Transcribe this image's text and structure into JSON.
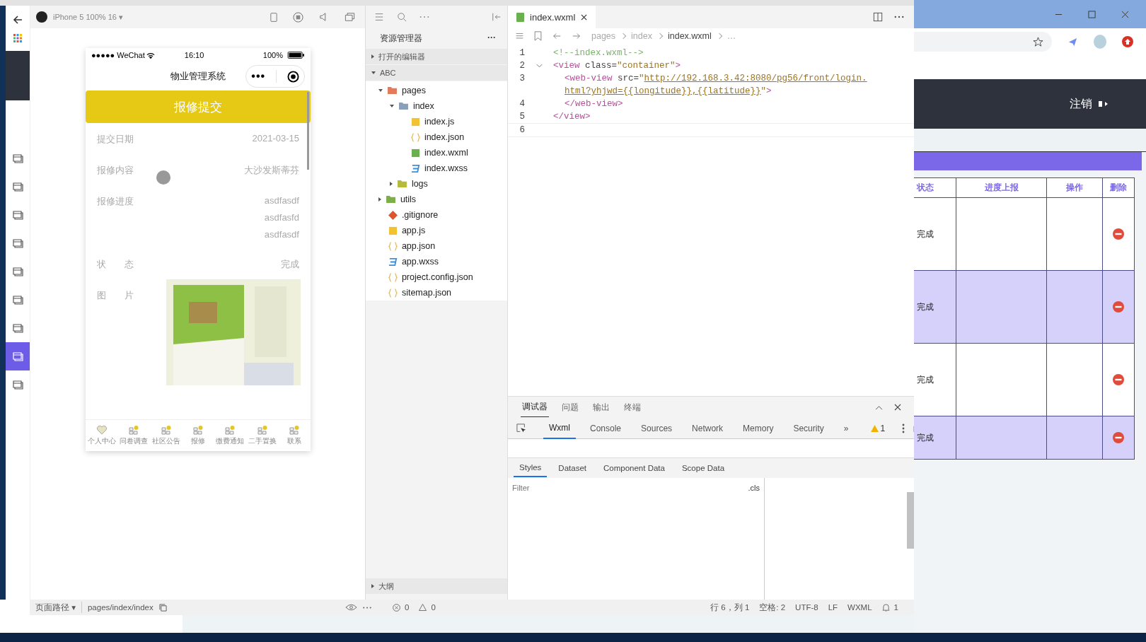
{
  "nav_sidebar": {
    "items": [
      {
        "selected": false
      },
      {
        "selected": false
      },
      {
        "selected": false
      },
      {
        "selected": false
      },
      {
        "selected": false
      },
      {
        "selected": false
      },
      {
        "selected": false
      },
      {
        "selected": true
      },
      {
        "selected": false
      }
    ]
  },
  "simulator": {
    "device": "iPhone 5 100% 16 ▾",
    "phone": {
      "carrier": "●●●●● WeChat",
      "time": "16:10",
      "battery": "100%",
      "title": "物业管理系统",
      "capsule_dots": "•••",
      "submit_button": "报修提交",
      "fields": [
        {
          "kind": "text",
          "label": "提交日期",
          "values": [
            "2021-03-15"
          ]
        },
        {
          "kind": "text",
          "label": "报修内容",
          "values": [
            "大沙发斯蒂芬"
          ]
        },
        {
          "kind": "text",
          "label": "报修进度",
          "values": [
            "asdfasdf",
            "asdfasfd",
            "asdfasdf"
          ]
        },
        {
          "kind": "text",
          "label": "状　　态",
          "values": [
            "完成"
          ]
        },
        {
          "kind": "image",
          "label": "图　　片"
        }
      ],
      "tabbar": [
        {
          "label": "个人中心",
          "kind": "heart"
        },
        {
          "label": "问卷调查",
          "kind": "grid"
        },
        {
          "label": "社区公告",
          "kind": "grid"
        },
        {
          "label": "报修",
          "kind": "grid"
        },
        {
          "label": "缴费通知",
          "kind": "grid"
        },
        {
          "label": "二手置换",
          "kind": "grid"
        },
        {
          "label": "联系",
          "kind": "grid"
        }
      ]
    },
    "page_path_label": "页面路径 ▾",
    "page_path": "pages/index/index"
  },
  "explorer": {
    "title": "资源管理器",
    "more": "···",
    "sections": [
      {
        "label": "打开的编辑器",
        "expanded": false
      },
      {
        "label": "ABC",
        "expanded": true
      }
    ],
    "tree": [
      {
        "name": "pages",
        "kind": "folder",
        "expanded": true,
        "children": [
          {
            "name": "index",
            "kind": "folder",
            "expanded": true,
            "children": [
              {
                "name": "index.js",
                "kind": "js"
              },
              {
                "name": "index.json",
                "kind": "json"
              },
              {
                "name": "index.wxml",
                "kind": "wxml"
              },
              {
                "name": "index.wxss",
                "kind": "wxss"
              }
            ]
          },
          {
            "name": "logs",
            "kind": "folder",
            "expanded": false
          }
        ]
      },
      {
        "name": "utils",
        "kind": "folder",
        "expanded": false
      },
      {
        "name": ".gitignore",
        "kind": "git"
      },
      {
        "name": "app.js",
        "kind": "js"
      },
      {
        "name": "app.json",
        "kind": "json"
      },
      {
        "name": "app.wxss",
        "kind": "wxss"
      },
      {
        "name": "project.config.json",
        "kind": "json"
      },
      {
        "name": "sitemap.json",
        "kind": "json"
      }
    ],
    "outline": {
      "label": "大纲",
      "expanded": false
    }
  },
  "editor": {
    "tabs": [
      {
        "label": "index.wxml",
        "selected": true
      }
    ],
    "breadcrumb": [
      "pages",
      "index",
      "index.wxml",
      "…"
    ],
    "lines": [
      {
        "num": "1",
        "tokens": [
          {
            "kind": "comment",
            "text": "<!--index.wxml-->"
          }
        ]
      },
      {
        "num": "2",
        "tokens": [
          {
            "kind": "tag",
            "text": "<view "
          },
          {
            "kind": "attr",
            "text": "class="
          },
          {
            "kind": "value",
            "text": "\"container\""
          },
          {
            "kind": "tag",
            "text": ">"
          }
        ],
        "children": [
          {
            "num": "3",
            "tokens": [
              {
                "kind": "tag",
                "text": "<web-view "
              },
              {
                "kind": "attr",
                "text": "src="
              },
              {
                "kind": "value",
                "text": "\""
              },
              {
                "kind": "url",
                "text": "http://192.168.3.42:8080/pg56/front/login."
              }
            ]
          },
          {
            "tokens": [
              {
                "kind": "url",
                "text": "html?yhjwd={{longitude}},{{latitude}}"
              },
              {
                "kind": "value",
                "text": "\""
              },
              {
                "kind": "tag",
                "text": ">"
              }
            ]
          },
          {
            "num": "4",
            "tokens": [
              {
                "kind": "tag",
                "text": "</web-view>"
              }
            ]
          }
        ]
      },
      {
        "num": "5",
        "tokens": [
          {
            "kind": "tag",
            "text": "</view>"
          }
        ]
      },
      {
        "num": "6",
        "current": true
      }
    ]
  },
  "devtools": {
    "panels": [
      {
        "label": "调试器",
        "selected": true
      },
      {
        "label": "问题",
        "selected": false
      },
      {
        "label": "输出",
        "selected": false
      },
      {
        "label": "终端",
        "selected": false
      }
    ],
    "tools": [
      {
        "label": "Wxml",
        "selected": true
      },
      {
        "label": "Console",
        "selected": false
      },
      {
        "label": "Sources",
        "selected": false
      },
      {
        "label": "Network",
        "selected": false
      },
      {
        "label": "Memory",
        "selected": false
      },
      {
        "label": "Security",
        "selected": false
      }
    ],
    "more_tools": "»",
    "warnings": "1",
    "subtabs": [
      {
        "label": "Styles",
        "selected": true
      },
      {
        "label": "Dataset",
        "selected": false
      },
      {
        "label": "Component Data",
        "selected": false
      },
      {
        "label": "Scope Data",
        "selected": false
      }
    ],
    "filter": {
      "placeholder": "Filter"
    },
    "cls": ".cls"
  },
  "status_bar": {
    "errors": "0",
    "warnings": "0",
    "position": "行 6，列 1",
    "spaces": "空格: 2",
    "encoding": "UTF-8",
    "eol": "LF",
    "language": "WXML",
    "notifications": "1"
  },
  "browser": {
    "logout": "注销",
    "table": {
      "columns": [
        "状态",
        "进度上报",
        "操作",
        "删除"
      ],
      "rows": [
        {
          "status": "完成"
        },
        {
          "status": "完成"
        },
        {
          "status": "完成"
        },
        {
          "status": "完成"
        }
      ]
    }
  }
}
